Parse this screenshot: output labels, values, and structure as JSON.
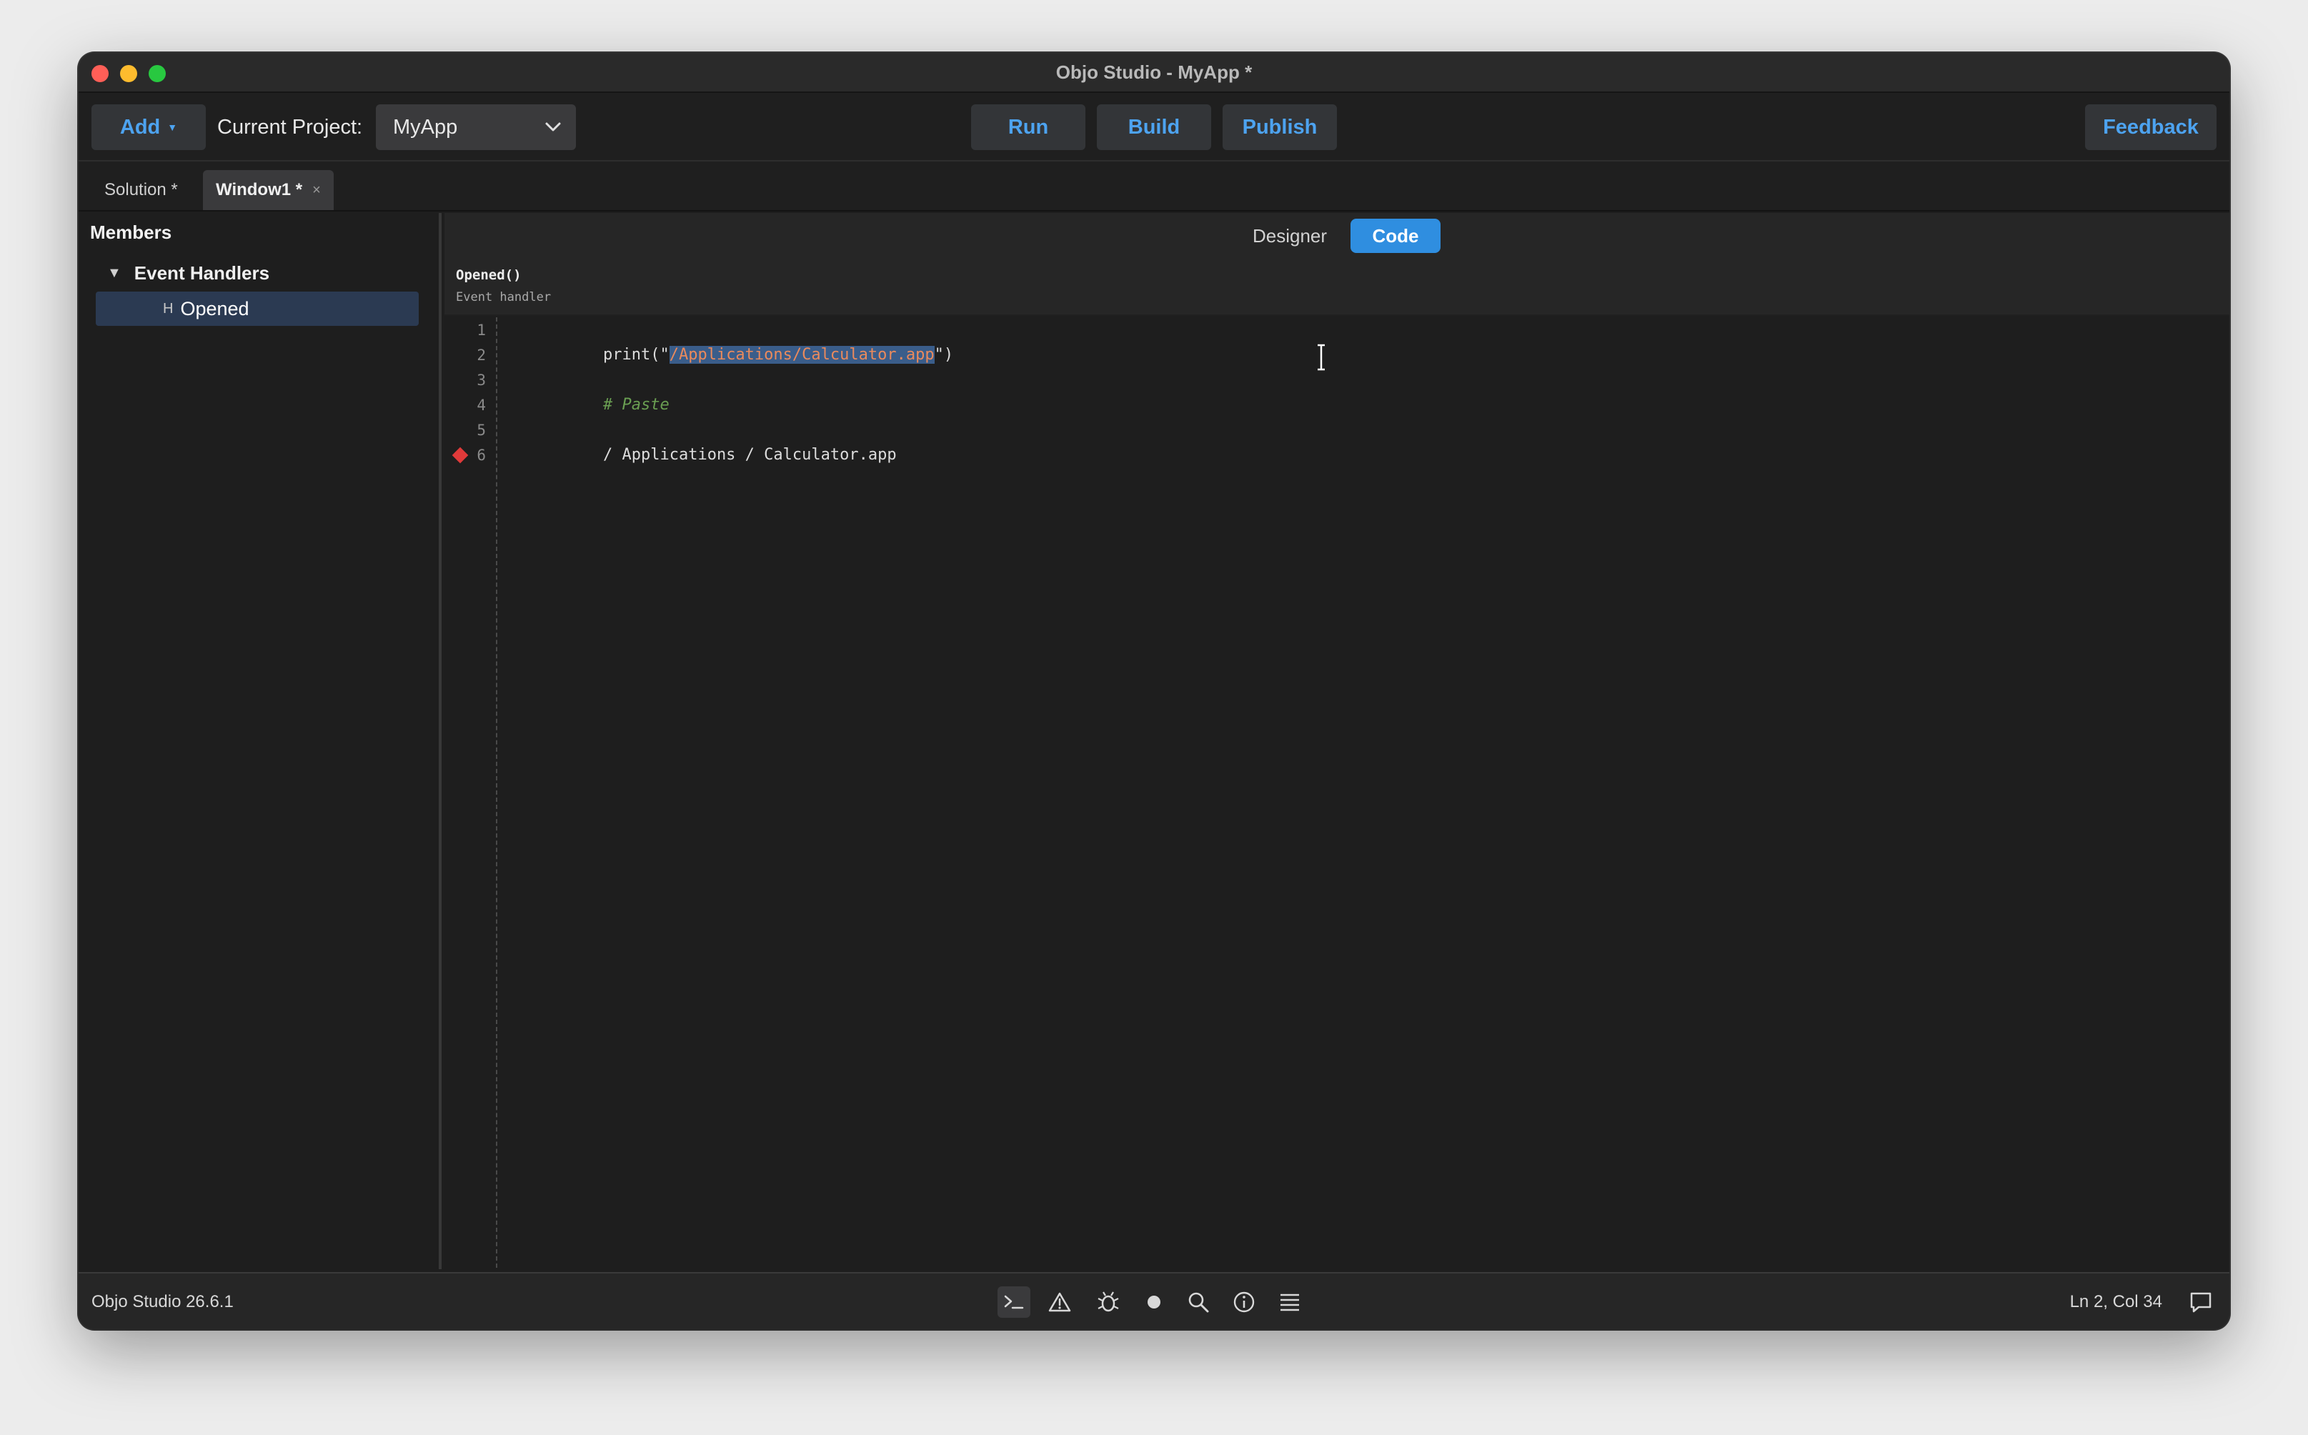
{
  "window": {
    "title": "Objo Studio - MyApp *"
  },
  "toolbar": {
    "add_label": "Add",
    "project_label": "Current Project:",
    "project_value": "MyApp",
    "run_label": "Run",
    "build_label": "Build",
    "publish_label": "Publish",
    "feedback_label": "Feedback"
  },
  "tabs": [
    {
      "label": "Solution *",
      "active": false
    },
    {
      "label": "Window1 *",
      "active": true,
      "close": "×"
    }
  ],
  "sidebar": {
    "title": "Members",
    "group_label": "Event Handlers",
    "handler_icon": "H",
    "handler_label": "Opened"
  },
  "editor": {
    "segments": {
      "designer": "Designer",
      "code": "Code"
    },
    "active_segment": "Code",
    "method_signature": "Opened()",
    "method_description": "Event handler",
    "lines": [
      {
        "number": "1",
        "text": ""
      },
      {
        "number": "2",
        "prefix": "print(\"",
        "selected": "/Applications/Calculator.app",
        "suffix": "\")"
      },
      {
        "number": "3",
        "text": ""
      },
      {
        "number": "4",
        "text": "# Paste",
        "comment": true
      },
      {
        "number": "5",
        "text": ""
      },
      {
        "number": "6",
        "text": "/ Applications / Calculator.app",
        "breakpoint": true
      }
    ]
  },
  "status": {
    "version": "Objo Studio 26.6.1",
    "position": "Ln 2, Col 34",
    "icons": [
      "terminal-icon",
      "warning-icon",
      "bug-icon",
      "record-icon",
      "search-icon",
      "info-icon",
      "list-icon"
    ],
    "active_icon": "terminal-icon"
  },
  "colors": {
    "accent": "#4da3f0",
    "active_segment": "#2f8ee0",
    "breakpoint": "#e03a3a",
    "comment": "#6a9f52",
    "selection": "#3a5d8a"
  }
}
